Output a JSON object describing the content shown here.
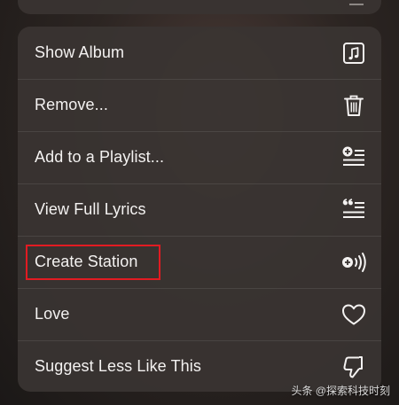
{
  "context_menu": {
    "items": [
      {
        "label": "Show Album",
        "icon": "album-icon"
      },
      {
        "label": "Remove...",
        "icon": "trash-icon"
      },
      {
        "label": "Add to a Playlist...",
        "icon": "add-to-playlist-icon"
      },
      {
        "label": "View Full Lyrics",
        "icon": "lyrics-icon"
      },
      {
        "label": "Create Station",
        "icon": "station-icon"
      },
      {
        "label": "Love",
        "icon": "heart-icon"
      },
      {
        "label": "Suggest Less Like This",
        "icon": "thumbs-down-icon"
      }
    ]
  },
  "annotation": {
    "highlight_color": "#e21b22"
  },
  "watermark": {
    "text": "头条 @探索科技时刻"
  },
  "colors": {
    "menu_background": "#3a3432",
    "text": "#f4f2f1"
  }
}
